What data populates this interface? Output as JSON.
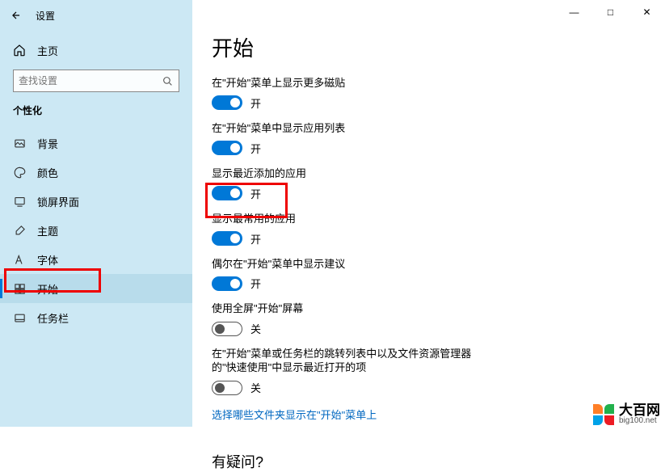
{
  "titlebar": {
    "app_name": "设置"
  },
  "win_controls": {
    "min": "—",
    "max": "□",
    "close": "✕"
  },
  "sidebar": {
    "home_label": "主页",
    "search_placeholder": "查找设置",
    "category": "个性化",
    "items": [
      {
        "label": "背景",
        "icon": "picture"
      },
      {
        "label": "颜色",
        "icon": "palette"
      },
      {
        "label": "锁屏界面",
        "icon": "lock-screen"
      },
      {
        "label": "主题",
        "icon": "brush"
      },
      {
        "label": "字体",
        "icon": "font"
      },
      {
        "label": "开始",
        "icon": "start"
      },
      {
        "label": "任务栏",
        "icon": "taskbar"
      }
    ]
  },
  "main": {
    "heading": "开始",
    "settings": [
      {
        "label": "在\"开始\"菜单上显示更多磁贴",
        "state_on": true,
        "state_text": "开"
      },
      {
        "label": "在\"开始\"菜单中显示应用列表",
        "state_on": true,
        "state_text": "开"
      },
      {
        "label": "显示最近添加的应用",
        "state_on": true,
        "state_text": "开"
      },
      {
        "label": "显示最常用的应用",
        "state_on": true,
        "state_text": "开"
      },
      {
        "label": "偶尔在\"开始\"菜单中显示建议",
        "state_on": true,
        "state_text": "开"
      },
      {
        "label": "使用全屏\"开始\"屏幕",
        "state_on": false,
        "state_text": "关"
      },
      {
        "label": "在\"开始\"菜单或任务栏的跳转列表中以及文件资源管理器的\"快速使用\"中显示最近打开的项",
        "state_on": false,
        "state_text": "关"
      }
    ],
    "link_text": "选择哪些文件夹显示在\"开始\"菜单上",
    "question_heading": "有疑问?"
  },
  "watermark": {
    "cn": "大百网",
    "en": "big100.net"
  }
}
